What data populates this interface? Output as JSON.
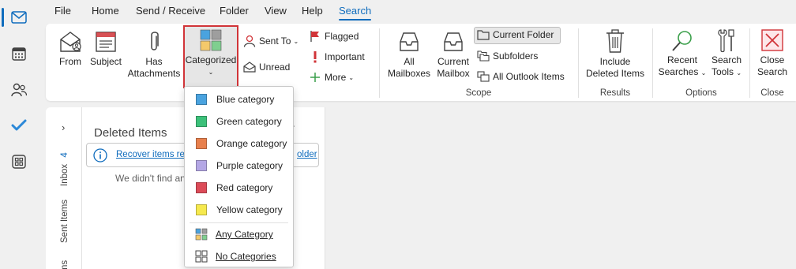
{
  "menu": {
    "tabs": [
      "File",
      "Home",
      "Send / Receive",
      "Folder",
      "View",
      "Help",
      "Search"
    ],
    "active_tab": "Search"
  },
  "ribbon": {
    "refine": {
      "from": "From",
      "subject": "Subject",
      "has_attachments": [
        "Has",
        "Attachments"
      ],
      "categorized": "Categorized",
      "sent_to": "Sent To",
      "unread": "Unread",
      "flagged": "Flagged",
      "important": "Important",
      "more": "More"
    },
    "scope": {
      "all_mailboxes": [
        "All",
        "Mailboxes"
      ],
      "current_mailbox": [
        "Current",
        "Mailbox"
      ],
      "current_folder": "Current Folder",
      "subfolders": "Subfolders",
      "all_outlook_items": "All Outlook Items",
      "label": "Scope"
    },
    "results": {
      "include_deleted": [
        "Include",
        "Deleted Items"
      ],
      "label": "Results"
    },
    "options": {
      "recent_searches": [
        "Recent",
        "Searches"
      ],
      "search_tools": [
        "Search",
        "Tools"
      ],
      "label": "Options"
    },
    "close": {
      "close_search": [
        "Close",
        "Search"
      ],
      "label": "Close"
    }
  },
  "folder_pane": {
    "inbox": "Inbox",
    "inbox_count": "4",
    "sent_items": "Sent Items",
    "next_partial": "Items"
  },
  "content": {
    "folder_title": "Deleted Items",
    "info_link": "Recover items rec",
    "info_link_tail": "older",
    "empty_message": "We didn't find an"
  },
  "category_menu": {
    "items": [
      {
        "label": "Blue category",
        "color": "#4aa3df"
      },
      {
        "label": "Green category",
        "color": "#3cc17a"
      },
      {
        "label": "Orange category",
        "color": "#e8804d"
      },
      {
        "label": "Purple category",
        "color": "#b4a7e5"
      },
      {
        "label": "Red category",
        "color": "#dc4b58"
      },
      {
        "label": "Yellow category",
        "color": "#f6e94e"
      }
    ],
    "any_category": "Any Category",
    "no_categories": "No Categories"
  },
  "colors": {
    "accent": "#0f6cbd",
    "highlight_border": "#d13438",
    "close_icon": "#d13438"
  }
}
